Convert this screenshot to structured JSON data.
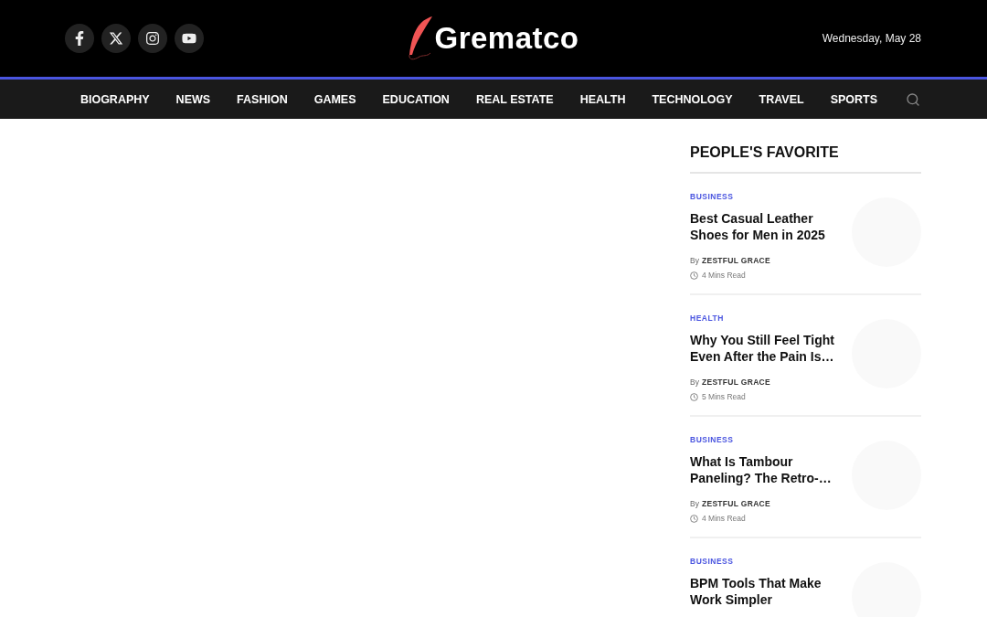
{
  "header": {
    "social": [
      {
        "kind": "facebook"
      },
      {
        "kind": "x"
      },
      {
        "kind": "instagram"
      },
      {
        "kind": "youtube"
      }
    ],
    "logo": "Grematco",
    "date": "Wednesday, May 28"
  },
  "nav": {
    "items": [
      "BIOGRAPHY",
      "NEWS",
      "FASHION",
      "GAMES",
      "EDUCATION",
      "REAL ESTATE",
      "HEALTH",
      "TECHNOLOGY",
      "TRAVEL",
      "SPORTS"
    ]
  },
  "sidebar": {
    "title": "PEOPLE'S FAVORITE",
    "articles": [
      {
        "category": "BUSINESS",
        "title": "Best Casual Leather Shoes for Men in 2025",
        "by": "By",
        "author": "ZESTFUL GRACE",
        "read_time": "4 Mins Read"
      },
      {
        "category": "HEALTH",
        "title": "Why You Still Feel Tight Even After the Pain Is…",
        "by": "By",
        "author": "ZESTFUL GRACE",
        "read_time": "5 Mins Read"
      },
      {
        "category": "BUSINESS",
        "title": "What Is Tambour Paneling? The Retro-…",
        "by": "By",
        "author": "ZESTFUL GRACE",
        "read_time": "4 Mins Read"
      },
      {
        "category": "BUSINESS",
        "title": "BPM Tools That Make Work Simpler"
      }
    ]
  }
}
